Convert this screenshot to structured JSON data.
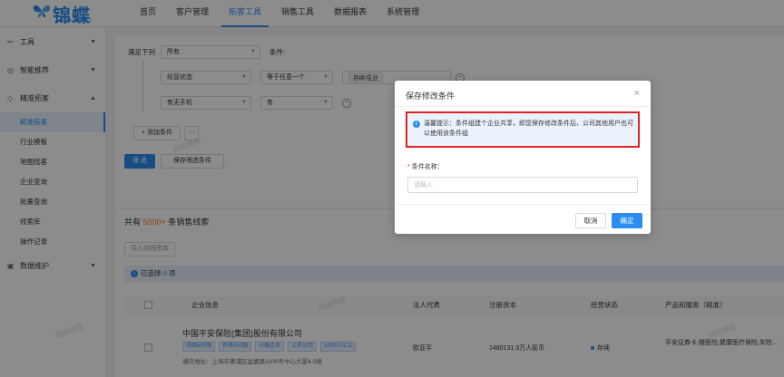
{
  "brand": {
    "name": "锦蝶",
    "sub": "JINCHEN.CC"
  },
  "nav": [
    "首页",
    "客户管理",
    "拓客工具",
    "销售工具",
    "数据报表",
    "系统管理"
  ],
  "sidebar": {
    "groups": [
      {
        "label": "工具",
        "icon": "tool-icon",
        "chev": "▼"
      },
      {
        "label": "智能推荐",
        "icon": "eye-icon",
        "chev": "▼"
      },
      {
        "label": "精准拓客",
        "icon": "target-icon",
        "chev": "▲"
      }
    ],
    "items": [
      "精准拓客",
      "行业模板",
      "地图找客",
      "企业查询",
      "批量查询",
      "线索库",
      "操作记录"
    ],
    "bottom": {
      "label": "数据维护",
      "icon": "data-icon",
      "chev": "▼"
    }
  },
  "filter": {
    "match_label": "满足下列",
    "match_value": "所有",
    "cond_label": "条件:",
    "row1": {
      "field": "经营状态",
      "op": "等于任意一个",
      "value": "存续/在业"
    },
    "row2": {
      "field": "有无手机",
      "op": "有"
    },
    "add_condition": "添加条件",
    "more": "···",
    "search_btn": "筛 选",
    "save_btn": "保存筛选条件"
  },
  "results": {
    "prefix": "共有",
    "count": "5000+",
    "suffix": "条销售线索",
    "import_btn": "导入到线索库",
    "selected_label": "已选择",
    "selected_count": "0",
    "selected_unit": "项",
    "columns": [
      "企业信息",
      "法人代表",
      "注册资本",
      "经营状态",
      "产品和服务（精准）"
    ],
    "row": {
      "company": "中国平安保险(集团)股份有限公司",
      "tags": [
        "中国500强",
        "世界500强",
        "小微企业",
        "上市公司",
        "1000人以上"
      ],
      "address_label": "通讯地址：",
      "address": "上海市黄浦区益嘉路1000号中心大厦4-5楼",
      "legal_rep": "欧亚平",
      "capital": "1480131.3万人民币",
      "status": "存续",
      "products": "平安证券卡,赠医险,健康医疗保险,车险..."
    }
  },
  "watermark": "网络锦蝶",
  "modal": {
    "title": "保存修改条件",
    "close": "×",
    "notice_icon": "i",
    "notice": "温馨提示：条件组建个企业共享，即您保存修改条件后，公司其他用户也可以使用该条件组",
    "field_label": "条件名称：",
    "input_placeholder": "请输入",
    "cancel": "取消",
    "ok": "确定"
  },
  "colors": {
    "accent": "#2b8df0",
    "highlight_border": "#e02424",
    "count": "#f5822a"
  }
}
